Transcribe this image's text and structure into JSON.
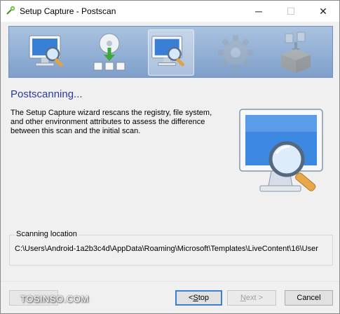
{
  "window": {
    "title": "Setup Capture - Postscan",
    "controls": {
      "minimize": "─",
      "maximize": "☐",
      "close": "✕"
    }
  },
  "steps": [
    {
      "icon": "monitor-magnifier-icon",
      "state": "done"
    },
    {
      "icon": "disc-install-icon",
      "state": "done"
    },
    {
      "icon": "monitor-magnifier-icon",
      "state": "current"
    },
    {
      "icon": "gear-icon",
      "state": "pending"
    },
    {
      "icon": "package-icon",
      "state": "pending"
    }
  ],
  "main": {
    "heading": "Postscanning...",
    "description": "The Setup Capture wizard rescans the registry, file system, and other environment attributes to assess the difference between this scan and the initial scan."
  },
  "scanning": {
    "label": "Scanning location",
    "path": "C:\\Users\\Android-1a2b3c4d\\AppData\\Roaming\\Microsoft\\Templates\\LiveContent\\16\\User"
  },
  "buttons": {
    "stop_prefix": "< ",
    "stop_hotkey": "S",
    "stop_rest": "top",
    "next_hotkey": "N",
    "next_rest": "ext >",
    "cancel": "Cancel"
  },
  "watermark": "TOSINSO.COM",
  "colors": {
    "heading": "#2a3a9c",
    "step_bar": "#8fabd3",
    "focus_border": "#3c7fd1"
  }
}
